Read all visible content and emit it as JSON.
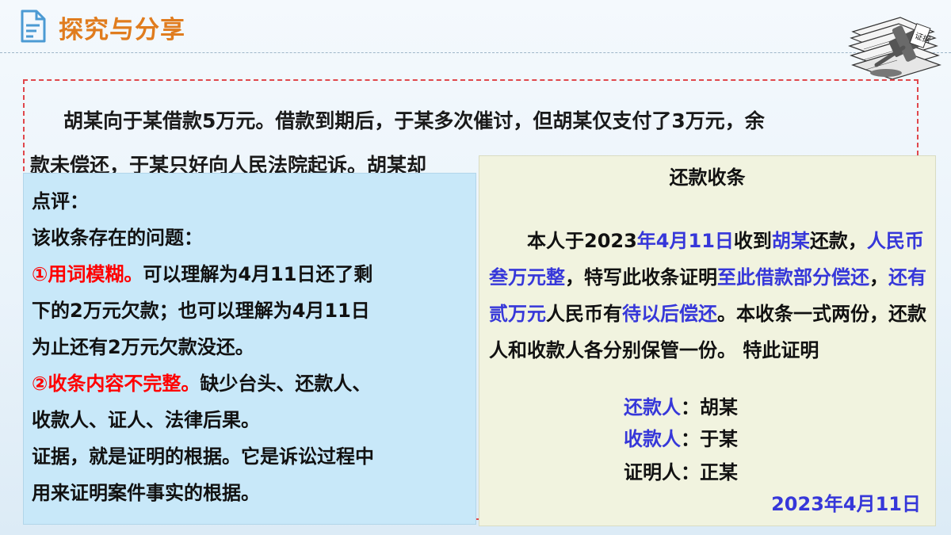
{
  "header": {
    "title": "探究与分享"
  },
  "evidence_image": {
    "stamp_text": "证据"
  },
  "case": {
    "line1": "胡某向于某借款5万元。借款到期后，于某多次催讨，但胡某仅支付了3万元，余",
    "line2": "款未偿还，于某只好向人民法院起诉。胡某却"
  },
  "comment": {
    "heading": "点评：",
    "question": "该收条存在的问题：",
    "point1_label": "①用词模糊。",
    "point1_text_a": "可以理解为4月11日还了剩",
    "point1_text_b": "下的2万元欠款；也可以理解为4月11日",
    "point1_text_c": "为止还有2万元欠款没还。",
    "point2_label": "②收条内容不完整。",
    "point2_text_a": "缺少台头、还款人、",
    "point2_text_b": "收款人、证人、法律后果。",
    "def_a": "证据，就是证明的根据。它是诉讼过程中",
    "def_b": "用来证明案件事实的根据。"
  },
  "receipt": {
    "title": "还款收条",
    "s1": "本人于2023",
    "s2": "年4月11日",
    "s3": "收到",
    "s4": "胡某",
    "s5": "还款，",
    "s6": "人民币叁万元整",
    "s7": "，特写此收条证明",
    "s8": "至此借款部分偿还",
    "s9": "，",
    "s10": "还有贰万元",
    "s11": "人民币有",
    "s12": "待以后偿还",
    "s13": "。本收条一式两份，还款人和收款人各分别保管一份。 特此证明",
    "payer_label": "还款人",
    "payer_name": "：胡某",
    "payee_label": "收款人",
    "payee_name": "：于某",
    "witness": "证明人：正某",
    "date": "2023年4月11日"
  },
  "colors": {
    "title": "#e07c1e",
    "red": "#ff0000",
    "blue": "#3637d9",
    "comment_bg": "#c8e8f9",
    "receipt_bg": "#f1f3df"
  }
}
